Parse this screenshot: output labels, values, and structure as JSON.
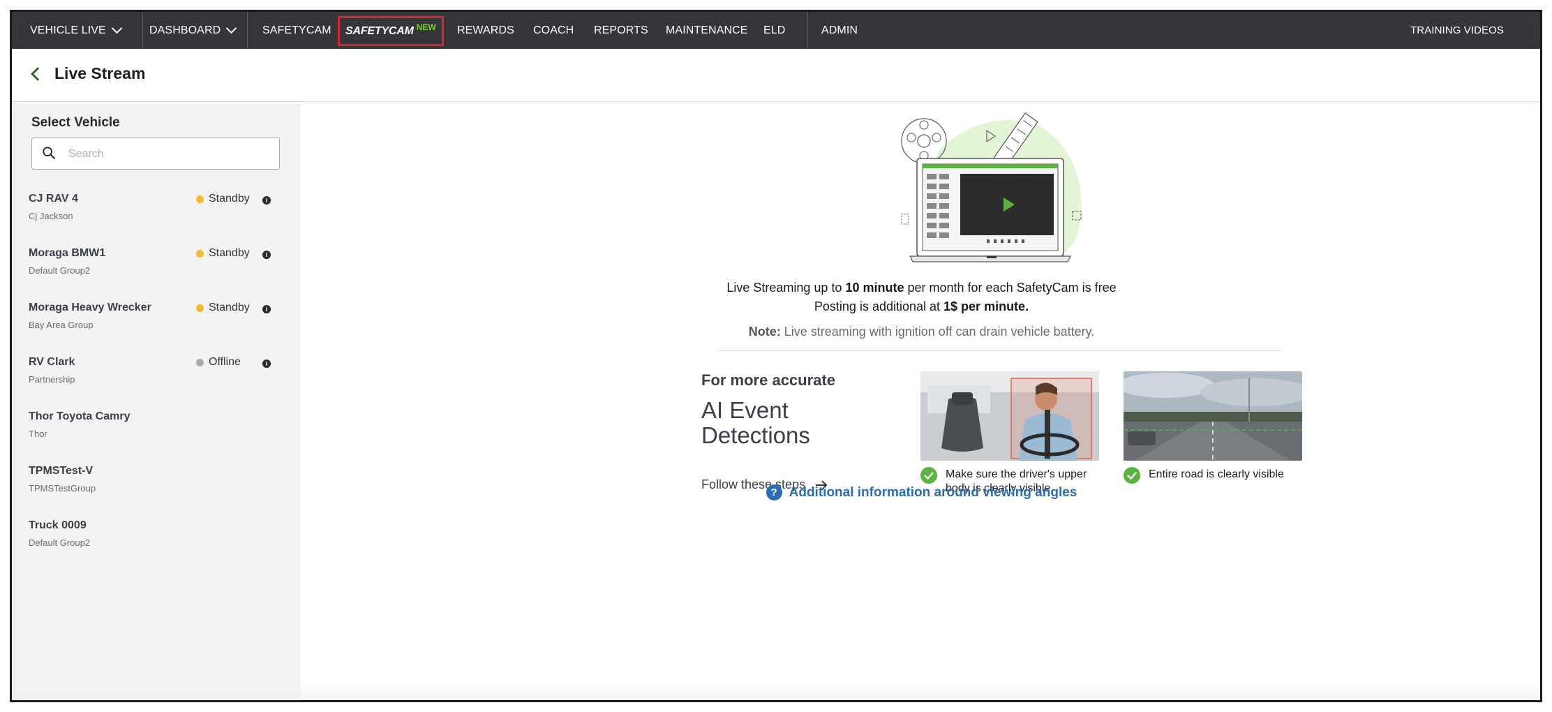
{
  "nav": {
    "vehicle_live": "VEHICLE LIVE",
    "dashboard": "DASHBOARD",
    "safetycam": "SAFETYCAM",
    "safetycam_new_brand": "SAFETYCAM",
    "safetycam_new_tag": "NEW",
    "rewards": "REWARDS",
    "coach": "COACH",
    "reports": "REPORTS",
    "maintenance": "MAINTENANCE",
    "eld": "ELD",
    "admin": "ADMIN",
    "training_videos": "TRAINING VIDEOS"
  },
  "header": {
    "title": "Live Stream"
  },
  "sidebar": {
    "heading": "Select Vehicle",
    "search_placeholder": "Search",
    "vehicles": [
      {
        "name": "CJ RAV 4",
        "group": "Cj Jackson",
        "status": "Standby",
        "status_color": "#f5b82e"
      },
      {
        "name": "Moraga BMW1",
        "group": "Default Group2",
        "status": "Standby",
        "status_color": "#f5b82e"
      },
      {
        "name": "Moraga Heavy Wrecker",
        "group": "Bay Area Group",
        "status": "Standby",
        "status_color": "#f5b82e"
      },
      {
        "name": "RV Clark",
        "group": "Partnership",
        "status": "Offline",
        "status_color": "#a9a9a9"
      },
      {
        "name": "Thor Toyota Camry",
        "group": "Thor"
      },
      {
        "name": "TPMSTest-V",
        "group": "TPMSTestGroup"
      },
      {
        "name": "Truck 0009",
        "group": "Default Group2"
      }
    ]
  },
  "main": {
    "line1_a": "Live Streaming up to ",
    "line1_b": "10 minute",
    "line1_c": " per month for each SafetyCam is free",
    "line2_a": "Posting is additional at ",
    "line2_b": "1$ per minute.",
    "note_label": "Note:",
    "note_text": " Live streaming with ignition off can drain vehicle battery.",
    "ai_sub": "For more accurate",
    "ai_title": "AI Event Detections",
    "follow": "Follow these steps",
    "example1_caption": "Make sure the driver's upper body is clearly visible",
    "example2_caption": "Entire road is clearly visible",
    "help_link": "Additional information around viewing angles"
  },
  "colors": {
    "nav_bg": "#34363a",
    "accent_green": "#5bb33f",
    "link_blue": "#2a6db5",
    "highlight_red": "#d9232d"
  }
}
